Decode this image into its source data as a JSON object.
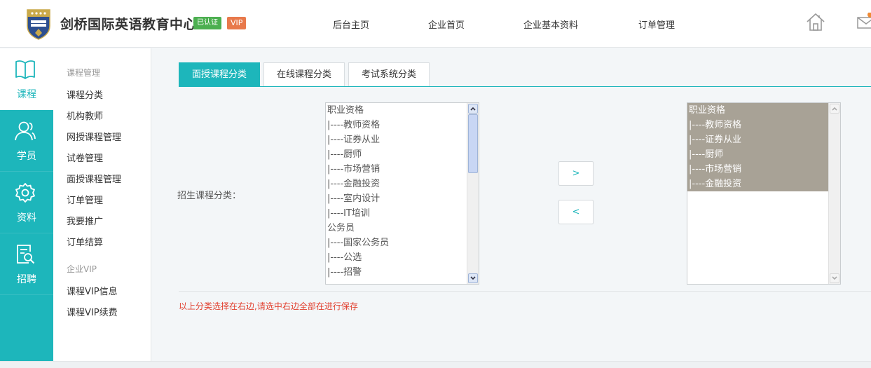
{
  "header": {
    "company_name": "剑桥国际英语教育中心",
    "verified_badge": "已认证",
    "vip_badge": "VIP",
    "nav": [
      "后台主页",
      "企业首页",
      "企业基本资料",
      "订单管理"
    ],
    "home_icon": "home-icon",
    "mail_icon": "mail-icon"
  },
  "rail": {
    "items": [
      {
        "label": "课程",
        "icon": "book-icon",
        "active": true
      },
      {
        "label": "学员",
        "icon": "users-icon",
        "active": false
      },
      {
        "label": "资料",
        "icon": "gear-icon",
        "active": false
      },
      {
        "label": "招聘",
        "icon": "resume-search-icon",
        "active": false
      }
    ]
  },
  "submenu": {
    "group1_title": "课程管理",
    "group1_items": [
      "课程分类",
      "机构教师",
      "网授课程管理",
      "试卷管理",
      "面授课程管理",
      "订单管理",
      "我要推广",
      "订单结算"
    ],
    "group2_title": "企业VIP",
    "group2_items": [
      "课程VIP信息",
      "课程VIP续费"
    ]
  },
  "main": {
    "tabs": [
      {
        "label": "面授课程分类",
        "active": true
      },
      {
        "label": "在线课程分类",
        "active": false
      },
      {
        "label": "考试系统分类",
        "active": false
      }
    ],
    "field_label": "招生课程分类：",
    "left_options": [
      "职业资格",
      "|----教师资格",
      "|----证券从业",
      "|----厨师",
      "|----市场营销",
      "|----金融投资",
      "|----室内设计",
      "|----IT培训",
      "公务员",
      "|----国家公务员",
      "|----公选",
      "|----招警"
    ],
    "right_options": [
      "职业资格",
      "|----教师资格",
      "|----证券从业",
      "|----厨师",
      "|----市场营销",
      "|----金融投资"
    ],
    "move_right_label": ">",
    "move_left_label": "<",
    "hint": "以上分类选择在右边,请选中右边全部在进行保存"
  },
  "colors": {
    "accent": "#1db6bb",
    "selected_option_bg": "#a8a296",
    "hint": "#e2402f",
    "verified_badge": "#4caf50",
    "vip_badge": "#e8794b"
  }
}
